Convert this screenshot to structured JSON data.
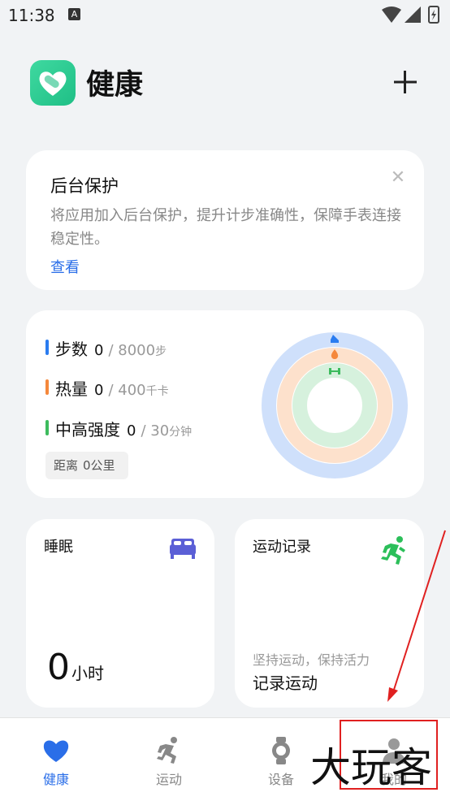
{
  "status_bar": {
    "time": "11:38",
    "notification_letter": "A"
  },
  "header": {
    "app_title": "健康",
    "logo_icon": "health-heart-logo-icon",
    "add_icon": "plus-icon"
  },
  "background_protection": {
    "title": "后台保护",
    "description": "将应用加入后台保护，提升计步准确性，保障手表连接稳定性。",
    "link": "查看",
    "close_icon": "close-icon"
  },
  "activity": {
    "metrics": [
      {
        "label": "步数",
        "value": "0",
        "goal": "/ 8000",
        "unit": "步",
        "color": "#2a7cf0"
      },
      {
        "label": "热量",
        "value": "0",
        "goal": "/ 400",
        "unit": "千卡",
        "color": "#f5883c"
      },
      {
        "label": "中高强度",
        "value": "0",
        "goal": "/ 30",
        "unit": "分钟",
        "color": "#3dbb5d"
      }
    ],
    "distance_label": "距离",
    "distance_value": "0公里",
    "rings": {
      "steps_progress": 0,
      "calories_progress": 0,
      "intensity_progress": 0,
      "colors": {
        "steps": "#cfe0fb",
        "calories": "#fde1cc",
        "intensity": "#d6f1dd"
      }
    }
  },
  "sleep": {
    "title": "睡眠",
    "value": "0",
    "unit": "小时",
    "icon": "bed-icon",
    "icon_color": "#5b5fd6"
  },
  "workout_record": {
    "title": "运动记录",
    "subtitle": "坚持运动，保持活力",
    "action": "记录运动",
    "icon": "running-icon",
    "icon_color": "#2cbf5a"
  },
  "bottom_nav": {
    "items": [
      {
        "label": "健康",
        "icon": "heart-icon",
        "active": true
      },
      {
        "label": "运动",
        "icon": "running-icon",
        "active": false
      },
      {
        "label": "设备",
        "icon": "watch-icon",
        "active": false
      },
      {
        "label": "我的",
        "icon": "person-icon",
        "active": false
      }
    ],
    "active_color": "#2a6ee8"
  },
  "watermark": "大玩客"
}
